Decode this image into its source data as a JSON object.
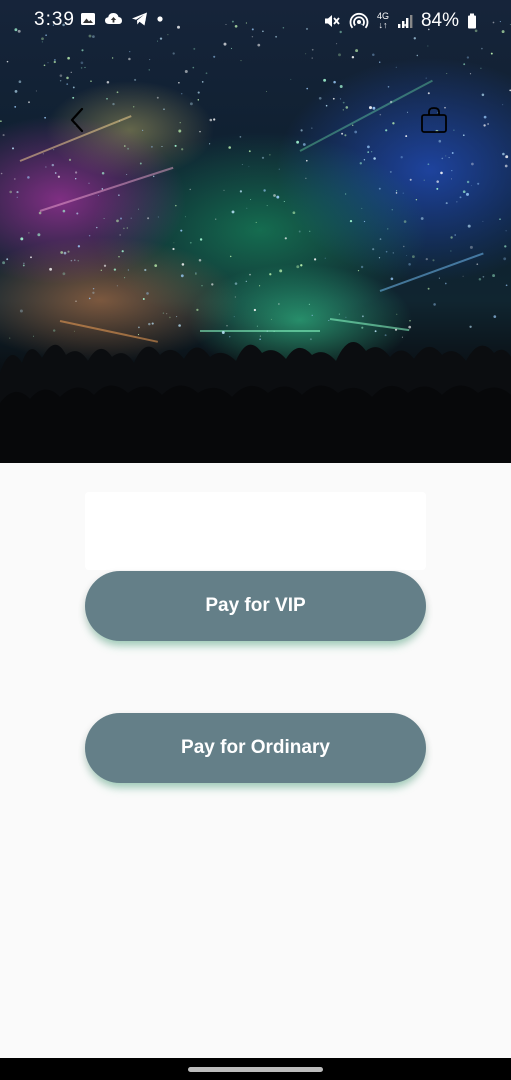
{
  "status_bar": {
    "time": "3:39",
    "battery": "84%",
    "left_icons": [
      "image-icon",
      "cloud-upload-icon",
      "telegram-icon",
      "dot-icon"
    ],
    "right_icons": [
      "mute-icon",
      "hotspot-icon",
      "network-4g-icon",
      "signal-icon",
      "battery-icon"
    ],
    "network_label": "4G"
  },
  "app_bar": {
    "back_icon": "chevron-left-icon",
    "cart_icon": "shopping-bag-icon"
  },
  "hero": {
    "image": "concert-crowd-image"
  },
  "payment": {
    "input_placeholder": "",
    "vip_label": "Pay for VIP",
    "ordinary_label": "Pay for Ordinary"
  },
  "colors": {
    "button": "#647f88",
    "background": "#fafafa",
    "button_glow": "#3cc88c"
  }
}
